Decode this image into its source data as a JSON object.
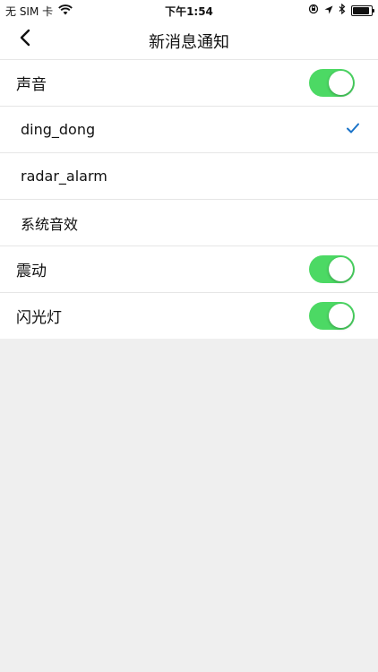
{
  "status": {
    "carrier": "无 SIM 卡",
    "time": "下午1:54",
    "battery_level": 0.9
  },
  "nav": {
    "title": "新消息通知",
    "back_icon": "chevron-left-icon"
  },
  "settings": {
    "sound": {
      "label": "声音",
      "enabled": true
    },
    "tones": [
      {
        "label": "ding_dong",
        "selected": true
      },
      {
        "label": "radar_alarm",
        "selected": false
      },
      {
        "label": "系统音效",
        "selected": false
      }
    ],
    "vibrate": {
      "label": "震动",
      "enabled": true
    },
    "flash": {
      "label": "闪光灯",
      "enabled": true
    }
  },
  "colors": {
    "toggle_on": "#4cd964",
    "check": "#1a73c8",
    "background": "#efefef"
  }
}
